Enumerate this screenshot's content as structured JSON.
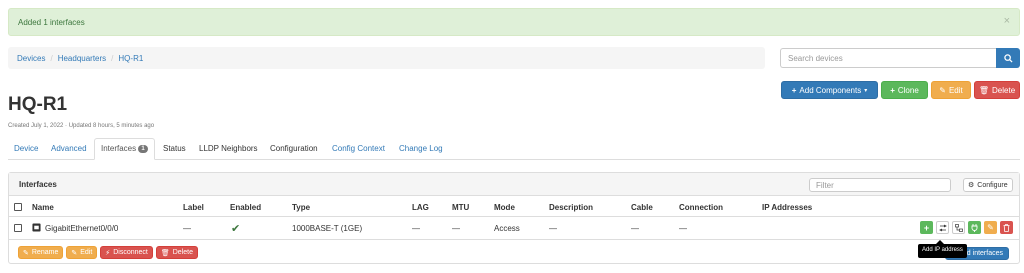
{
  "alert": {
    "message": "Added 1 interfaces",
    "close": "×"
  },
  "breadcrumb": [
    "Devices",
    "Headquarters",
    "HQ-R1"
  ],
  "search": {
    "placeholder": "Search devices"
  },
  "actions": {
    "add_components": "Add Components",
    "clone": "Clone",
    "edit": "Edit",
    "delete": "Delete"
  },
  "device": {
    "name": "HQ-R1",
    "meta": "Created July 1, 2022 · Updated 8 hours, 5 minutes ago"
  },
  "tabs": [
    {
      "label": "Device"
    },
    {
      "label": "Advanced"
    },
    {
      "label": "Interfaces",
      "badge": "1",
      "active": true
    },
    {
      "label": "Status"
    },
    {
      "label": "LLDP Neighbors"
    },
    {
      "label": "Configuration"
    },
    {
      "label": "Config Context"
    },
    {
      "label": "Change Log"
    }
  ],
  "interfaces": {
    "title": "Interfaces",
    "filter_placeholder": "Filter",
    "configure": "Configure",
    "columns": [
      "Name",
      "Label",
      "Enabled",
      "Type",
      "LAG",
      "MTU",
      "Mode",
      "Description",
      "Cable",
      "Connection",
      "IP Addresses"
    ],
    "rows": [
      {
        "name": "GigabitEthernet0/0/0",
        "label": "—",
        "enabled": "✔",
        "type": "1000BASE-T (1GE)",
        "lag": "—",
        "mtu": "—",
        "mode": "Access",
        "description": "—",
        "cable": "—",
        "connection": "—",
        "ip_addresses": ""
      }
    ],
    "bulk": {
      "rename": "Rename",
      "edit": "Edit",
      "disconnect": "Disconnect",
      "delete": "Delete"
    },
    "add_interfaces": "Add interfaces",
    "tooltip": "Add IP address"
  },
  "colors": {
    "primary": "#337ab7",
    "success": "#5cb85c",
    "warning": "#f0ad4e",
    "danger": "#d9534f",
    "info": "#5bc0de",
    "alert_bg": "#dff0d8"
  }
}
